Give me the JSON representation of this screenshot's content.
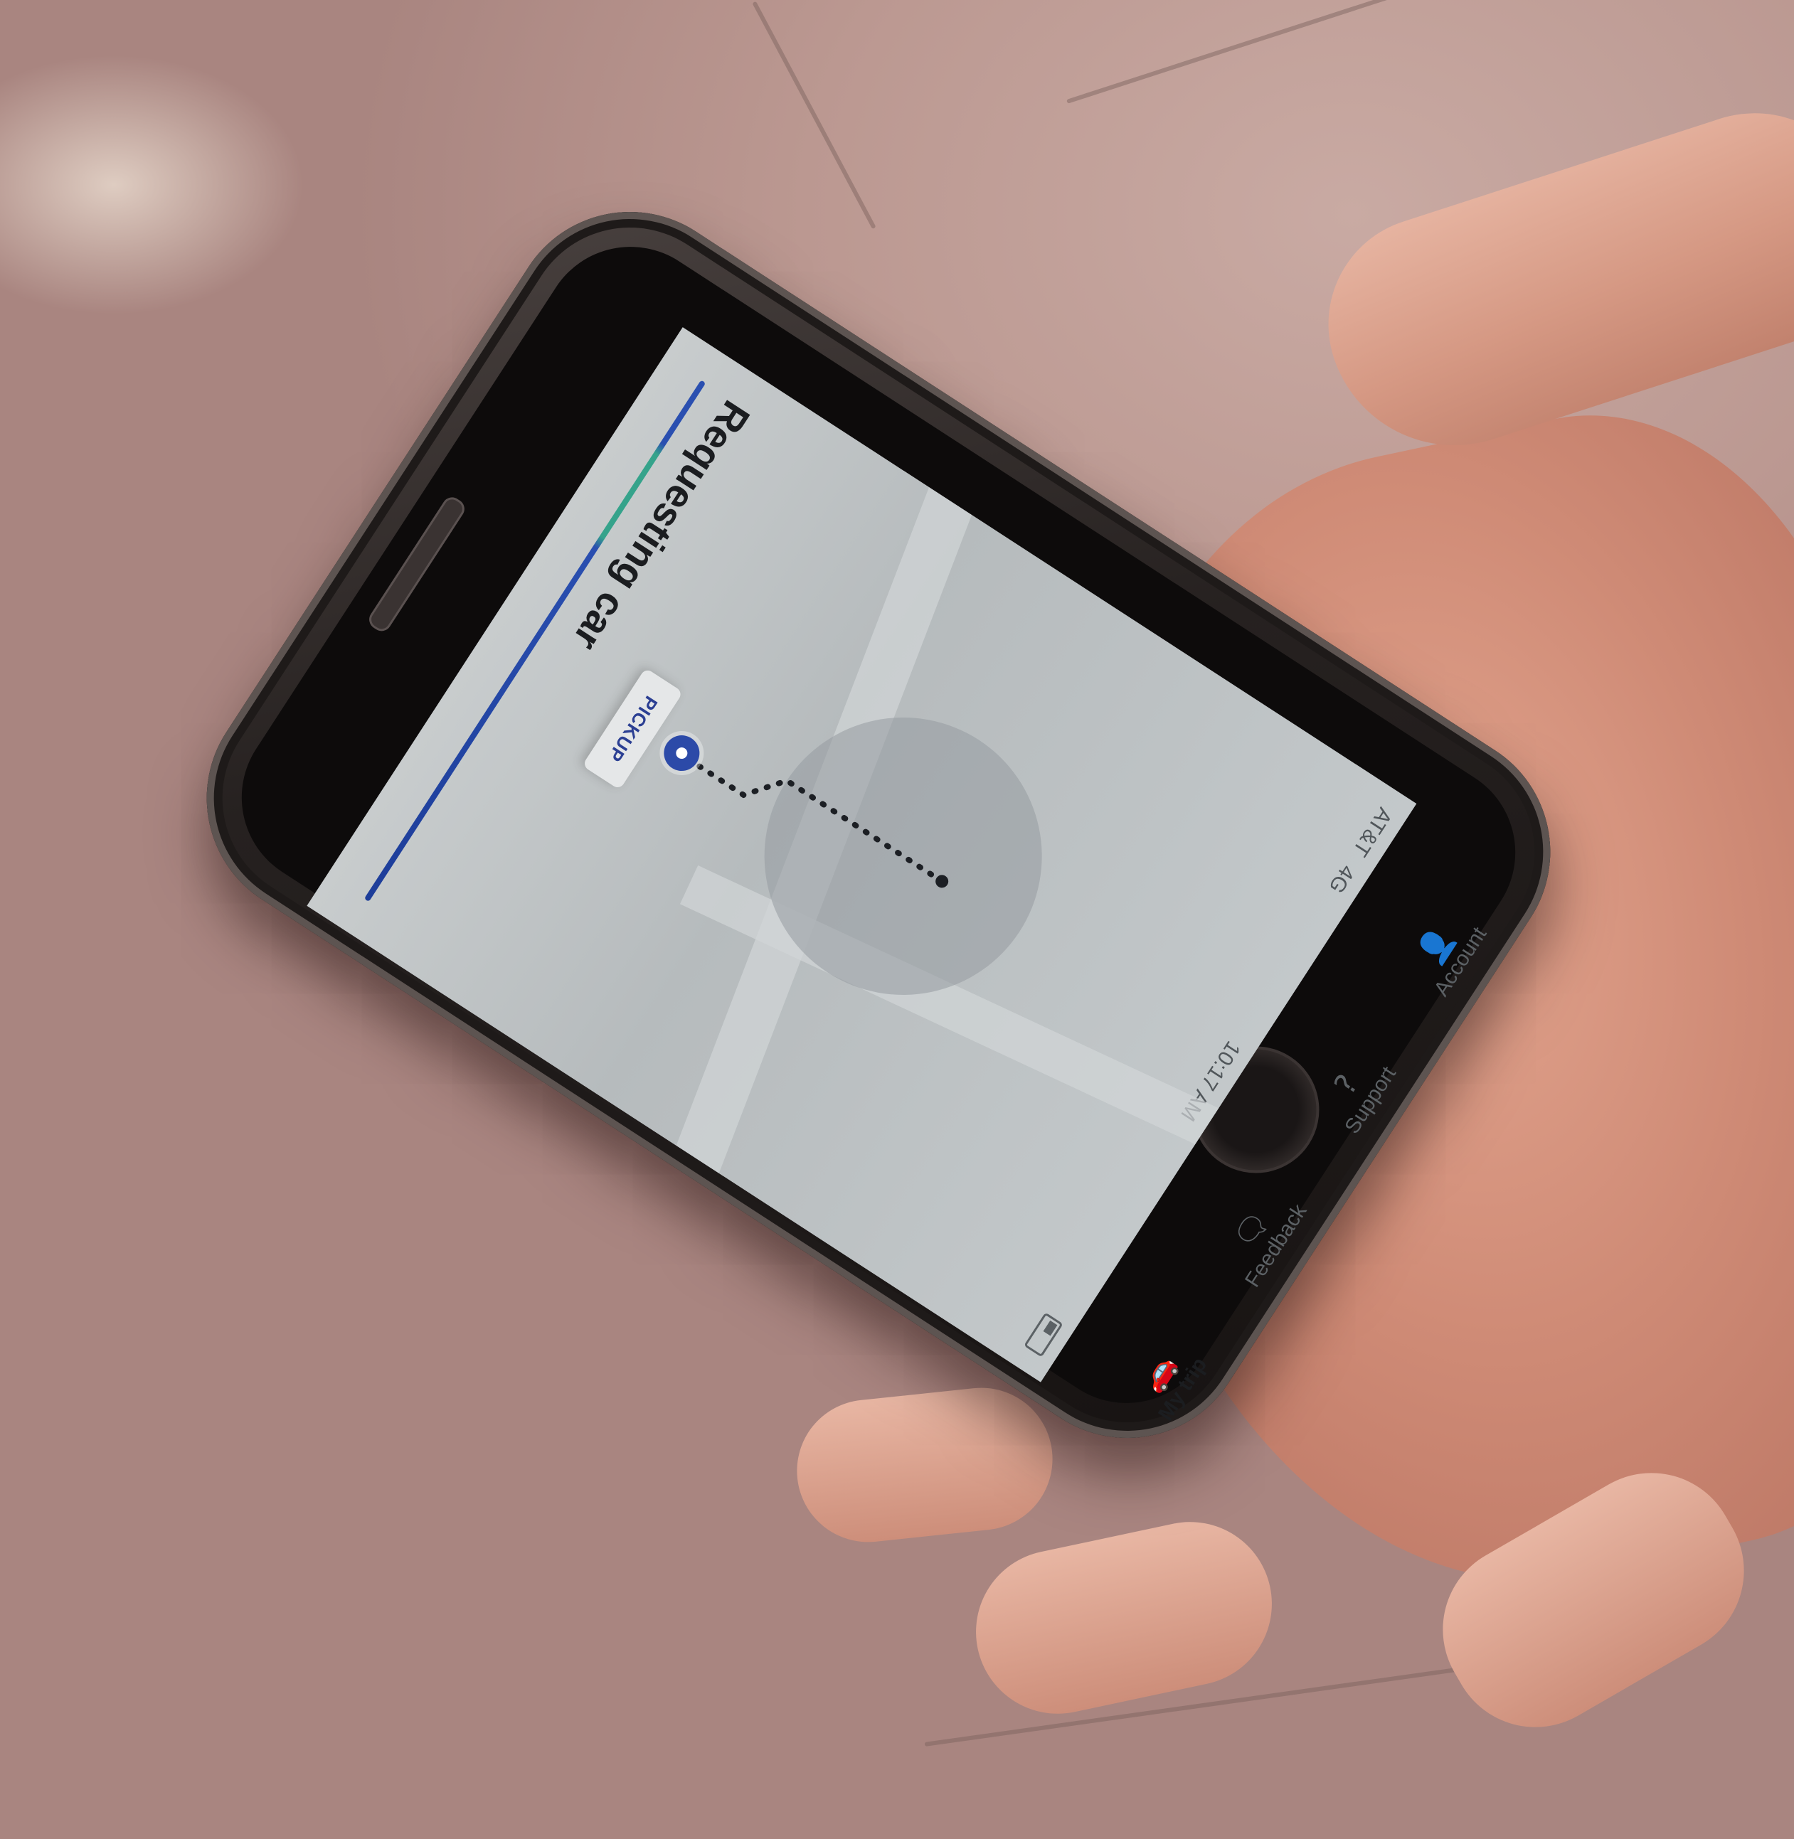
{
  "status_bar": {
    "carrier": "AT&T",
    "network": "4G",
    "time": "10:17 AM"
  },
  "map": {
    "pickup_label": "PICKUP"
  },
  "trip": {
    "status": "Requesting car",
    "progress": 0.0
  },
  "tab_bar": {
    "tabs": [
      {
        "label": "My trip",
        "icon": "car-icon",
        "active": true
      },
      {
        "label": "Feedback",
        "icon": "chat-bubble-icon",
        "active": false
      },
      {
        "label": "Support",
        "icon": "question-circle-icon",
        "active": false
      },
      {
        "label": "Account",
        "icon": "person-icon",
        "active": false
      }
    ]
  },
  "colors": {
    "accent_blue": "#2c4aa8",
    "accent_green": "#35a38b"
  }
}
